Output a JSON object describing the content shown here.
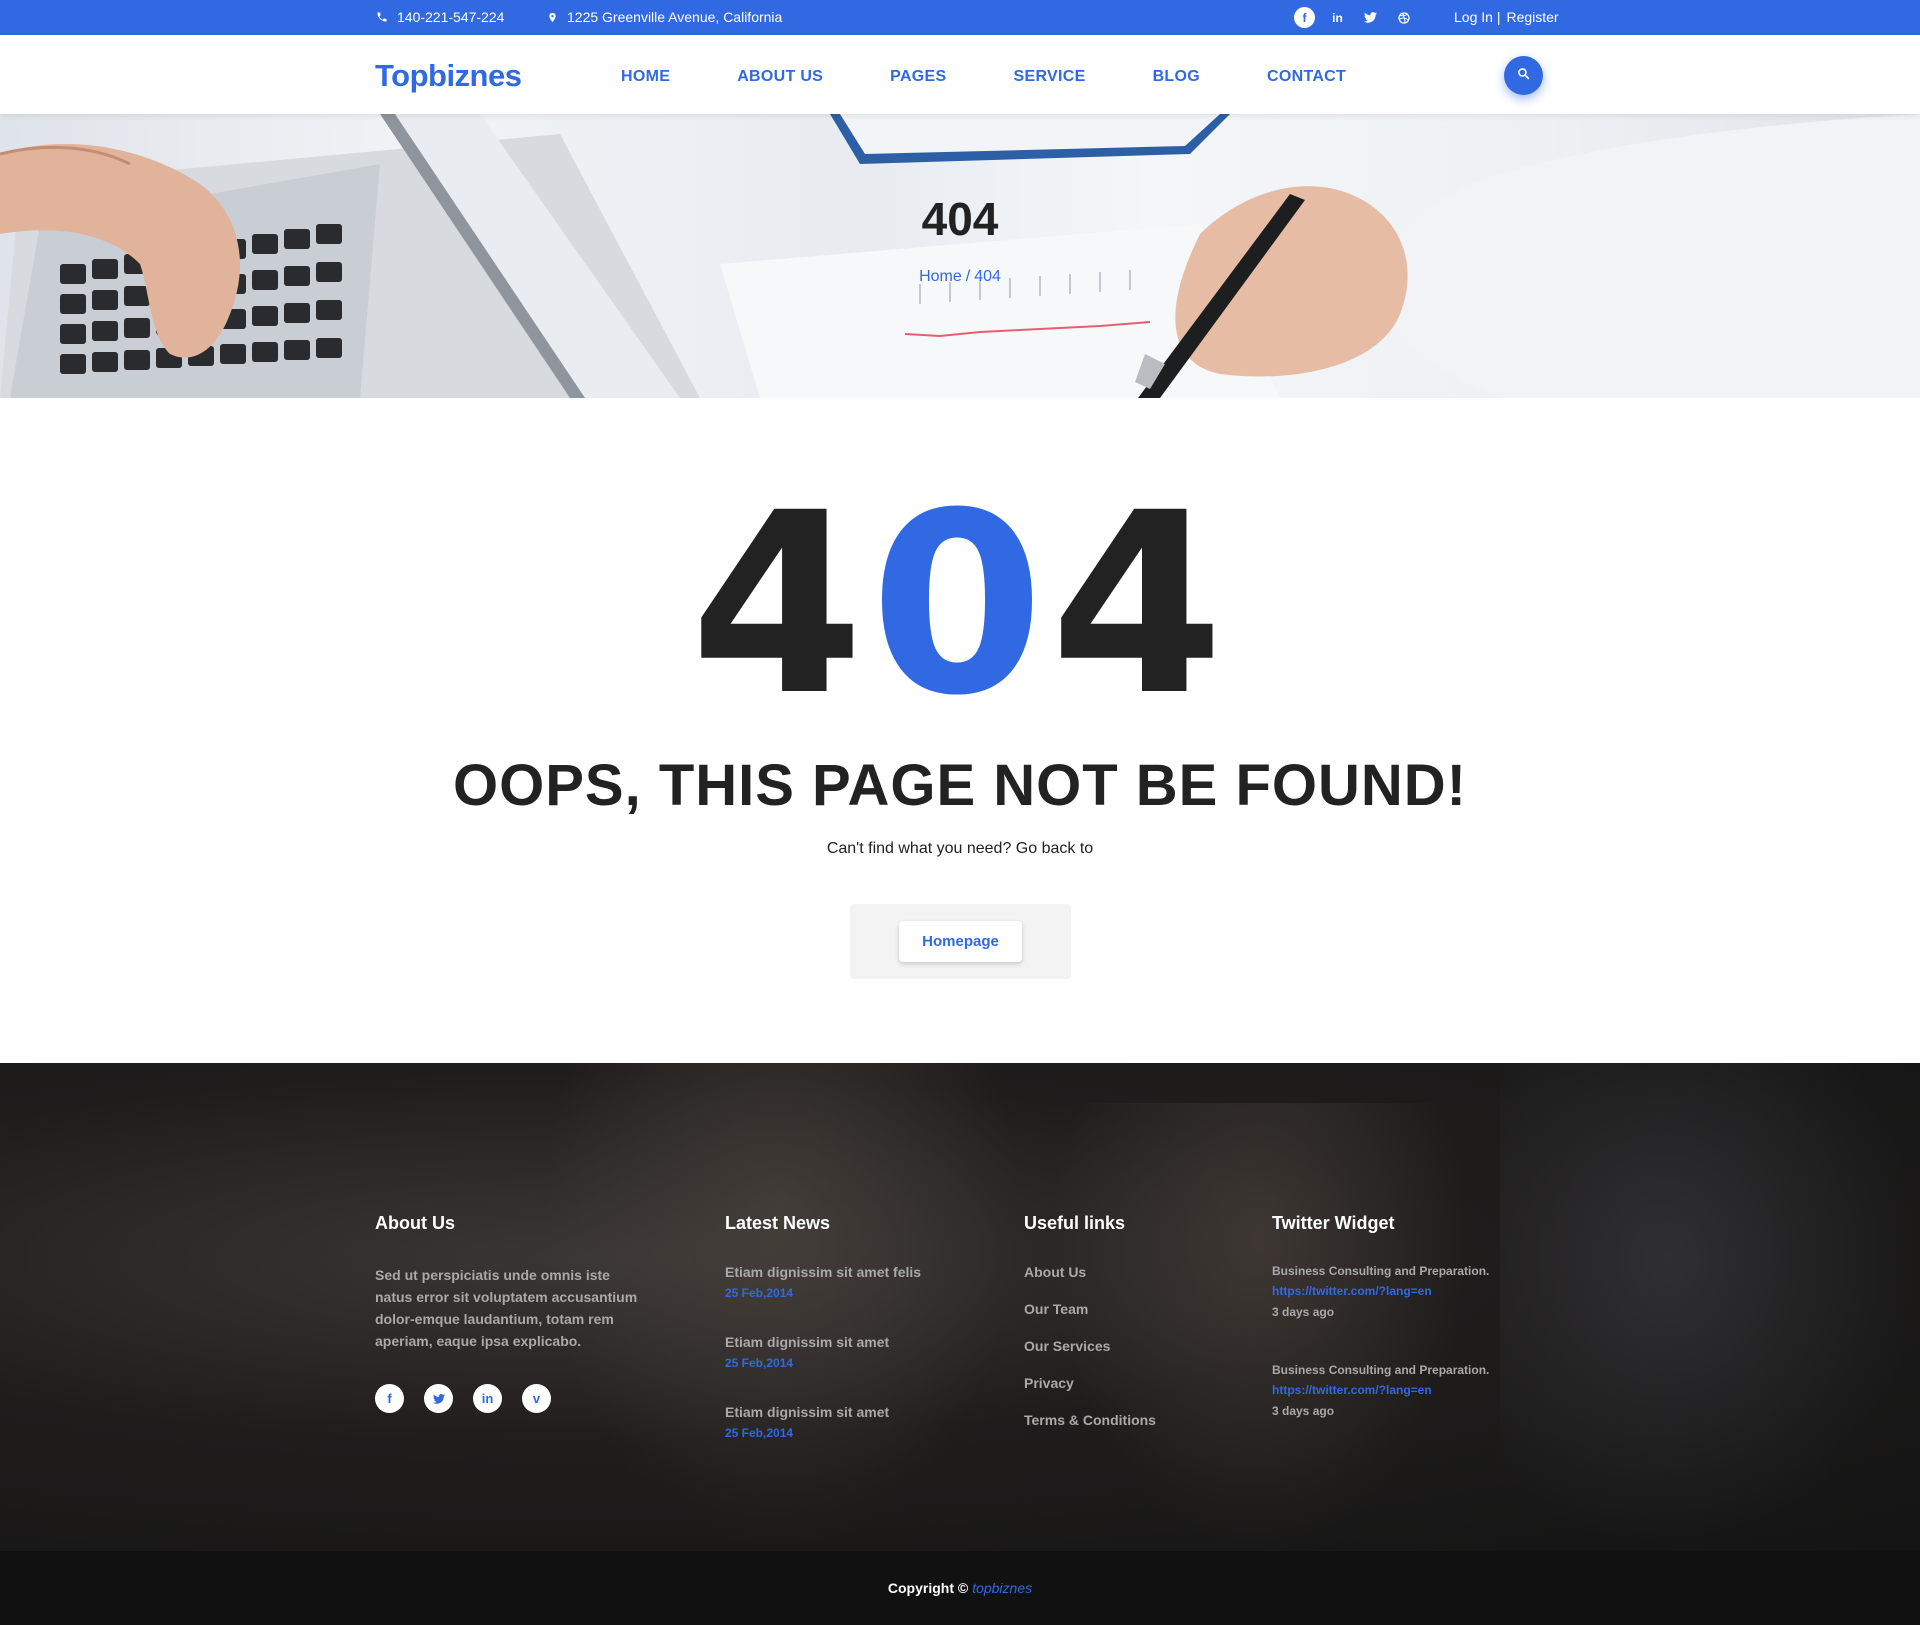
{
  "topbar": {
    "phone": "140-221-547-224",
    "address": "1225 Greenville Avenue, California",
    "social": [
      "f",
      "in",
      "t",
      "d"
    ],
    "login": "Log In |",
    "register": "Register"
  },
  "header": {
    "logo": "Topbiznes",
    "nav": [
      "HOME",
      "ABOUT US",
      "PAGES",
      "SERVICE",
      "BLOG",
      "CONTACT"
    ]
  },
  "banner": {
    "title": "404",
    "breadcrumb_home": "Home",
    "breadcrumb_sep": "/",
    "breadcrumb_current": "404"
  },
  "error": {
    "digit1": "4",
    "digit2": "0",
    "digit3": "4",
    "headline": "OOPS, THIS PAGE NOT BE FOUND!",
    "subtext": "Can't find what you need? Go back to",
    "button": "Homepage"
  },
  "footer": {
    "about": {
      "title": "About Us",
      "text": "Sed ut perspiciatis unde omnis iste natus error sit voluptatem accusantium dolor-emque laudantium, totam rem aperiam, eaque ipsa explicabo.",
      "social": [
        "f",
        "t",
        "in",
        "v"
      ]
    },
    "news": {
      "title": "Latest News",
      "items": [
        {
          "title": "Etiam dignissim sit amet felis",
          "date": "25 Feb,2014"
        },
        {
          "title": "Etiam dignissim sit amet",
          "date": "25 Feb,2014"
        },
        {
          "title": "Etiam dignissim sit amet",
          "date": "25 Feb,2014"
        }
      ]
    },
    "links": {
      "title": "Useful links",
      "items": [
        "About Us",
        "Our Team",
        "Our Services",
        "Privacy",
        "Terms & Conditions"
      ]
    },
    "twitter": {
      "title": "Twitter Widget",
      "items": [
        {
          "text": "Business Consulting and Preparation.",
          "link": "https://twitter.com/?lang=en",
          "ago": "3 days ago"
        },
        {
          "text": "Business Consulting and Preparation.",
          "link": "https://twitter.com/?lang=en",
          "ago": "3 days ago"
        }
      ]
    }
  },
  "copyright": {
    "label": "Copyright ©",
    "brand": "topbiznes"
  },
  "colors": {
    "accent": "#3169e3",
    "dark_text": "#222222",
    "footer_bg": "#141414"
  }
}
